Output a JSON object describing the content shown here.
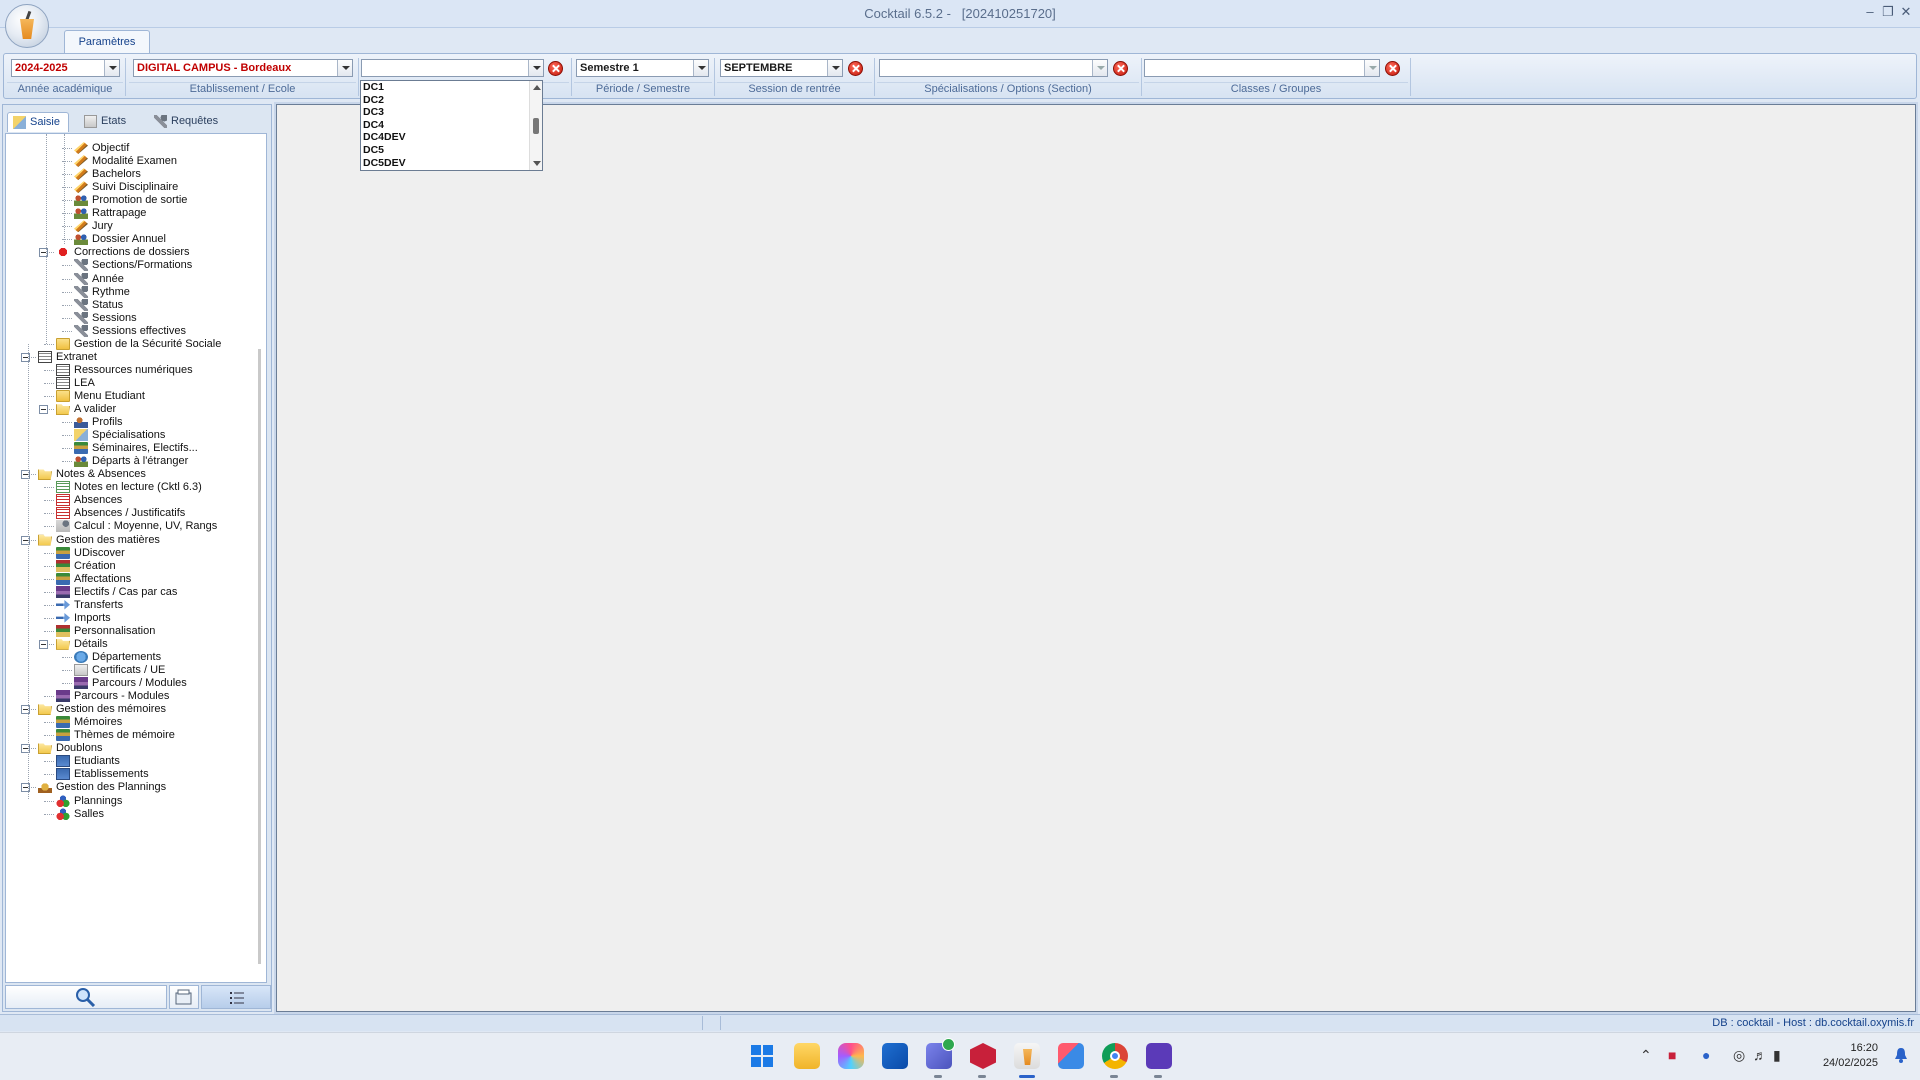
{
  "window": {
    "app_title": "Cocktail 6.5.2 -",
    "build": "[202410251720]",
    "controls": [
      "minimize-icon",
      "restore-icon",
      "close-icon"
    ]
  },
  "ribbon": {
    "tab_label": "Paramètres",
    "groups": [
      {
        "value": "2024-2025",
        "label": "Année académique"
      },
      {
        "value": "DIGITAL CAMPUS - Bordeaux",
        "label": "Etablissement / Ecole"
      },
      {
        "value": "",
        "label": ""
      },
      {
        "value": "Semestre 1",
        "label": "Période / Semestre"
      },
      {
        "value": "SEPTEMBRE",
        "label": "Session de rentrée"
      },
      {
        "value": "",
        "label": "Spécialisations / Options (Section)"
      },
      {
        "value": "",
        "label": "Classes / Groupes"
      }
    ],
    "dropdown_open_items": [
      "DC1",
      "DC2",
      "DC3",
      "DC4",
      "DC4DEV",
      "DC5",
      "DC5DEV"
    ]
  },
  "left_panel": {
    "tabs": [
      {
        "label": "Saisie",
        "icon": "edit-icon"
      },
      {
        "label": "Etats",
        "icon": "report-icon"
      },
      {
        "label": "Requêtes",
        "icon": "query-icon"
      }
    ],
    "tree": [
      {
        "label": "Objectif",
        "icon": "pencil"
      },
      {
        "label": "Modalité Examen",
        "icon": "pencil"
      },
      {
        "label": "Bachelors",
        "icon": "pencil"
      },
      {
        "label": "Suivi Disciplinaire",
        "icon": "pencil"
      },
      {
        "label": "Promotion de sortie",
        "icon": "people"
      },
      {
        "label": "Rattrapage",
        "icon": "people"
      },
      {
        "label": "Jury",
        "icon": "pencil"
      },
      {
        "label": "Dossier Annuel",
        "icon": "people"
      },
      {
        "label": "Corrections de dossiers",
        "icon": "red"
      },
      {
        "label": "Sections/Formations",
        "icon": "tool"
      },
      {
        "label": "Année",
        "icon": "tool"
      },
      {
        "label": "Rythme",
        "icon": "tool"
      },
      {
        "label": "Status",
        "icon": "tool"
      },
      {
        "label": "Sessions",
        "icon": "tool"
      },
      {
        "label": "Sessions effectives",
        "icon": "tool"
      },
      {
        "label": "Gestion de la Sécurité Sociale",
        "icon": "folder"
      },
      {
        "label": "Extranet",
        "icon": "web"
      },
      {
        "label": "Ressources numériques",
        "icon": "web"
      },
      {
        "label": "LEA",
        "icon": "web"
      },
      {
        "label": "Menu Etudiant",
        "icon": "folder"
      },
      {
        "label": "A valider",
        "icon": "folder-open"
      },
      {
        "label": "Profils",
        "icon": "profile"
      },
      {
        "label": "Spécialisations",
        "icon": "spec"
      },
      {
        "label": "Séminaires, Electifs...",
        "icon": "books"
      },
      {
        "label": "Départs à l'étranger",
        "icon": "people"
      },
      {
        "label": "Notes & Absences",
        "icon": "folder-open"
      },
      {
        "label": "Notes en lecture (Cktl 6.3)",
        "icon": "sheet"
      },
      {
        "label": "Absences",
        "icon": "sheet-red"
      },
      {
        "label": "Absences / Justificatifs",
        "icon": "sheet-red"
      },
      {
        "label": "Calcul : Moyenne, UV, Rangs",
        "icon": "calc"
      },
      {
        "label": "Gestion des matières",
        "icon": "folder-open"
      },
      {
        "label": "UDiscover",
        "icon": "books"
      },
      {
        "label": "Création",
        "icon": "books-red"
      },
      {
        "label": "Affectations",
        "icon": "books"
      },
      {
        "label": "Electifs / Cas par cas",
        "icon": "books-purple"
      },
      {
        "label": "Transferts",
        "icon": "transfer"
      },
      {
        "label": "Imports",
        "icon": "transfer"
      },
      {
        "label": "Personnalisation",
        "icon": "books-red"
      },
      {
        "label": "Détails",
        "icon": "folder-open"
      },
      {
        "label": "Départements",
        "icon": "globe"
      },
      {
        "label": "Certificats / UE",
        "icon": "cert"
      },
      {
        "label": "Parcours / Modules",
        "icon": "books-purple"
      },
      {
        "label": "Parcours - Modules",
        "icon": "books-purple"
      },
      {
        "label": "Gestion des mémoires",
        "icon": "folder-open"
      },
      {
        "label": "Mémoires",
        "icon": "books"
      },
      {
        "label": "Thèmes de mémoire",
        "icon": "books"
      },
      {
        "label": "Doublons",
        "icon": "folder-open"
      },
      {
        "label": "Etudiants",
        "icon": "student"
      },
      {
        "label": "Etablissements",
        "icon": "student"
      },
      {
        "label": "Gestion des Plannings",
        "icon": "plan2"
      },
      {
        "label": "Plannings",
        "icon": "plan"
      },
      {
        "label": "Salles",
        "icon": "plan"
      }
    ],
    "bottom_buttons": [
      "search-icon",
      "archive-icon",
      "list-icon"
    ]
  },
  "statusbar": {
    "db_info": "DB : cocktail - Host : db.cocktail.oxymis.fr"
  },
  "taskbar": {
    "apps": [
      "windows-start-icon",
      "file-explorer-icon",
      "photos-icon",
      "outlook-icon",
      "teams-icon",
      "h-app-icon",
      "cocktail-app-icon",
      "snipping-tool-icon",
      "chrome-icon",
      "q-app-icon"
    ],
    "time": "16:20",
    "date": "24/02/2025"
  },
  "colors": {
    "accent": "#15428b",
    "ribbon_label": "#4d6b98",
    "red_value": "#c00000"
  }
}
